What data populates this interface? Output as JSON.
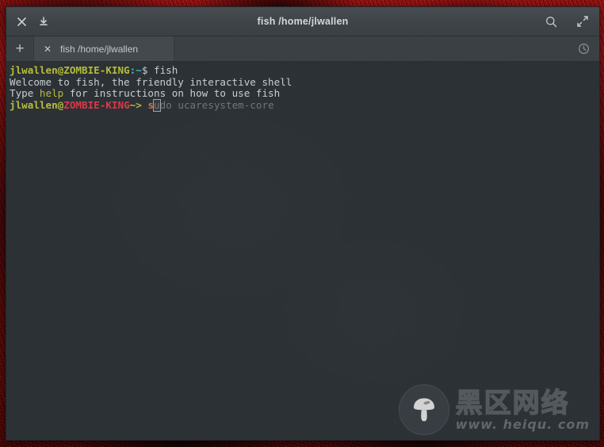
{
  "desktop": {
    "wallpaper_color": "#8e1212"
  },
  "window": {
    "titlebar": {
      "title": "fish  /home/jlwallen",
      "close_icon": "close-icon",
      "download_icon": "download-icon",
      "search_icon": "search-icon",
      "fullscreen_icon": "fullscreen-icon"
    },
    "tabbar": {
      "new_tab_label": "+",
      "history_icon": "history-clock-icon",
      "tabs": [
        {
          "close_label": "✕",
          "label": "fish  /home/jlwallen",
          "active": true
        }
      ]
    }
  },
  "terminal": {
    "colors": {
      "background": "#2c3135",
      "foreground": "#c8cdd1",
      "prompt_user": "#b5bd3c",
      "prompt_host_red": "#d93a4a",
      "prompt_path_cyan": "#3fb8c4",
      "keyword_green": "#b5bd3c",
      "command_orange": "#d2703a",
      "autosuggest_gray": "#6e757a",
      "cursor_outline": "#99a3ab"
    },
    "lines": [
      {
        "id": "line-1-prompt-command",
        "segments": [
          {
            "text": "jlwallen@ZOMBIE-KING",
            "color": "prompt_user",
            "bold": true
          },
          {
            "text": ":~",
            "color": "prompt_path_cyan",
            "bold": true
          },
          {
            "text": "$",
            "color": "foreground",
            "bold": false
          },
          {
            "text": " fish",
            "color": "foreground",
            "bold": false
          }
        ]
      },
      {
        "id": "line-2-welcome",
        "segments": [
          {
            "text": "Welcome to fish, the friendly interactive shell",
            "color": "foreground",
            "bold": false
          }
        ]
      },
      {
        "id": "line-3-help-hint",
        "segments": [
          {
            "text": "Type ",
            "color": "foreground",
            "bold": false
          },
          {
            "text": "help",
            "color": "keyword_green",
            "bold": false
          },
          {
            "text": " for instructions on how to use fish",
            "color": "foreground",
            "bold": false
          }
        ]
      },
      {
        "id": "line-4-fish-prompt",
        "segments": [
          {
            "text": "jlwallen@",
            "color": "prompt_user",
            "bold": true
          },
          {
            "text": "ZOMBIE-KING",
            "color": "prompt_host_red",
            "bold": true
          },
          {
            "text": "~>",
            "color": "prompt_user",
            "bold": true
          },
          {
            "text": " ",
            "color": "foreground",
            "bold": false
          },
          {
            "text": "s",
            "color": "command_orange",
            "bold": true
          },
          {
            "text": "u",
            "color": "autosuggest_gray",
            "bold": false,
            "cursor": true
          },
          {
            "text": "do ucaresystem-core",
            "color": "autosuggest_gray",
            "bold": false
          }
        ]
      }
    ],
    "current_input": "s",
    "autosuggestion": "sudo ucaresystem-core"
  },
  "watermark": {
    "logo_icon": "mushroom-logo-icon",
    "site_name_cn": "黑区网络",
    "site_url": "www. heiqu. com"
  }
}
